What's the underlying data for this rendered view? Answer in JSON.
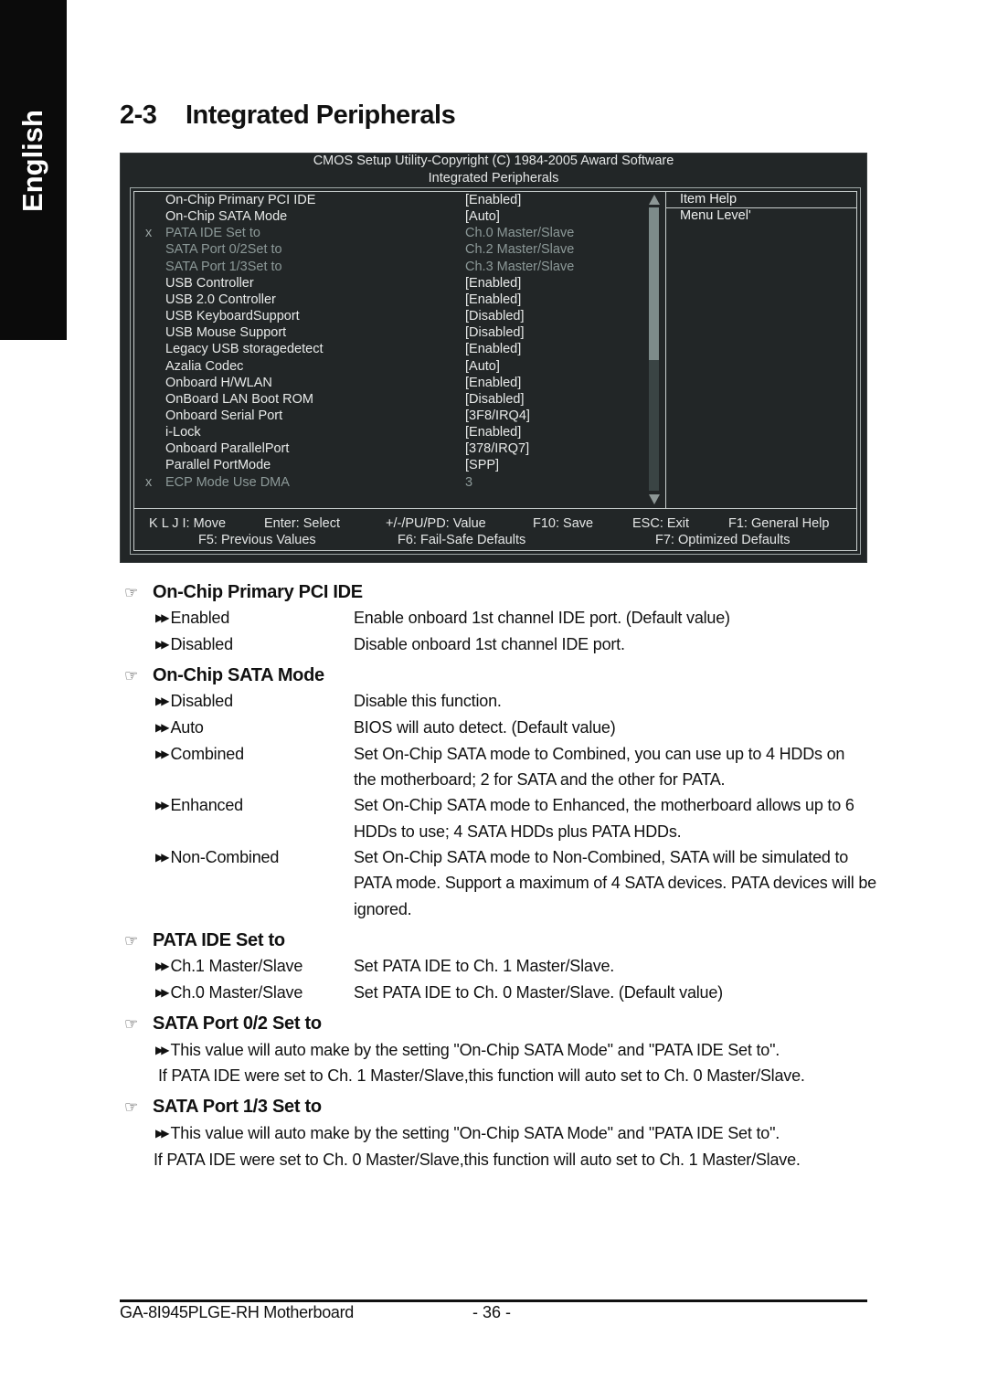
{
  "language_tab": "English",
  "section": {
    "number": "2-3",
    "title": "Integrated Peripherals"
  },
  "bios": {
    "header_line1": "CMOS Setup Utility-Copyright (C) 1984-2005 Award Software",
    "header_line2": "Integrated Peripherals",
    "items": [
      {
        "mark": "",
        "label": "On-Chip Primary PCI IDE",
        "value": "[Enabled]",
        "disabled": false
      },
      {
        "mark": "",
        "label": "On-Chip SATA Mode",
        "value": "[Auto]",
        "disabled": false
      },
      {
        "mark": "x",
        "label": "PATA IDE Set to",
        "value": "Ch.0 Master/Slave",
        "disabled": true
      },
      {
        "mark": "",
        "label": "SATA Port 0/2Set to",
        "value": "Ch.2 Master/Slave",
        "disabled": true
      },
      {
        "mark": "",
        "label": "SATA Port 1/3Set to",
        "value": "Ch.3 Master/Slave",
        "disabled": true
      },
      {
        "mark": "",
        "label": "USB Controller",
        "value": "[Enabled]",
        "disabled": false
      },
      {
        "mark": "",
        "label": "USB 2.0 Controller",
        "value": "[Enabled]",
        "disabled": false
      },
      {
        "mark": "",
        "label": "USB KeyboardSupport",
        "value": "[Disabled]",
        "disabled": false
      },
      {
        "mark": "",
        "label": "USB Mouse Support",
        "value": "[Disabled]",
        "disabled": false
      },
      {
        "mark": "",
        "label": "Legacy USB storagedetect",
        "value": "[Enabled]",
        "disabled": false
      },
      {
        "mark": "",
        "label": "Azalia Codec",
        "value": "[Auto]",
        "disabled": false
      },
      {
        "mark": "",
        "label": "Onboard H/WLAN",
        "value": "[Enabled]",
        "disabled": false
      },
      {
        "mark": "",
        "label": "OnBoard LAN Boot ROM",
        "value": "[Disabled]",
        "disabled": false
      },
      {
        "mark": "",
        "label": "Onboard Serial Port",
        "value": "[3F8/IRQ4]",
        "disabled": false
      },
      {
        "mark": "",
        "label": "i-Lock",
        "value": "[Enabled]",
        "disabled": false
      },
      {
        "mark": "",
        "label": "Onboard ParallelPort",
        "value": "[378/IRQ7]",
        "disabled": false
      },
      {
        "mark": "",
        "label": "Parallel PortMode",
        "value": "[SPP]",
        "disabled": false
      },
      {
        "mark": "x",
        "label": "ECP Mode Use DMA",
        "value": "3",
        "disabled": true
      }
    ],
    "help_title": "Item Help",
    "help_text": "Menu Level'",
    "scroll_visible_fraction": 0.54,
    "keys_row1": [
      "K L J I: Move",
      "Enter: Select",
      "+/-/PU/PD: Value",
      "F10: Save",
      "ESC: Exit",
      "F1: General Help"
    ],
    "keys_row2": [
      "F5: Previous Values",
      "F6: Fail-Safe Defaults",
      "F7: Optimized Defaults"
    ]
  },
  "sections": [
    {
      "title": "On-Chip Primary PCI IDE",
      "options": [
        {
          "name": "Enabled",
          "desc": [
            "Enable onboard 1st channel IDE port. (Default value)"
          ]
        },
        {
          "name": "Disabled",
          "desc": [
            "Disable onboard 1st channel IDE port."
          ]
        }
      ]
    },
    {
      "title": "On-Chip SATA Mode",
      "options": [
        {
          "name": "Disabled",
          "desc": [
            "Disable this function."
          ]
        },
        {
          "name": "Auto",
          "desc": [
            "BIOS will auto detect. (Default value)"
          ]
        },
        {
          "name": "Combined",
          "desc": [
            "Set On-Chip SATA mode to Combined, you can use up to 4 HDDs on",
            "the motherboard; 2 for SATA and the other for PATA."
          ]
        },
        {
          "name": "Enhanced",
          "desc": [
            "Set On-Chip SATA mode to Enhanced, the motherboard allows up to 6",
            "HDDs to use; 4 SATA HDDs plus PATA HDDs."
          ]
        },
        {
          "name": "Non-Combined",
          "desc": [
            "Set On-Chip SATA mode to Non-Combined, SATA will be simulated to",
            "PATA mode. Support a maximum of 4 SATA devices. PATA devices will be",
            "ignored."
          ]
        }
      ]
    },
    {
      "title": "PATA IDE Set to",
      "options": [
        {
          "name": "Ch.1 Master/Slave",
          "desc": [
            "Set PATA IDE to Ch. 1 Master/Slave."
          ]
        },
        {
          "name": "Ch.0 Master/Slave",
          "desc": [
            "Set PATA IDE to Ch. 0 Master/Slave. (Default value)"
          ]
        }
      ]
    },
    {
      "title": "SATA Port 0/2 Set to",
      "note": "This value will auto make by the setting \"On-Chip SATA Mode\" and \"PATA IDE Set to\".",
      "note2": "If PATA IDE were set to Ch. 1 Master/Slave,this function will auto set to Ch. 0 Master/Slave."
    },
    {
      "title": "SATA Port 1/3 Set to",
      "note": "This value will auto make by the setting \"On-Chip SATA Mode\" and \"PATA IDE Set to\".",
      "note2": "If PATA IDE were set to Ch. 0 Master/Slave,this function will auto set to Ch. 1 Master/Slave."
    }
  ],
  "footer": {
    "model": "GA-8I945PLGE-RH Motherboard",
    "page": "- 36 -"
  }
}
